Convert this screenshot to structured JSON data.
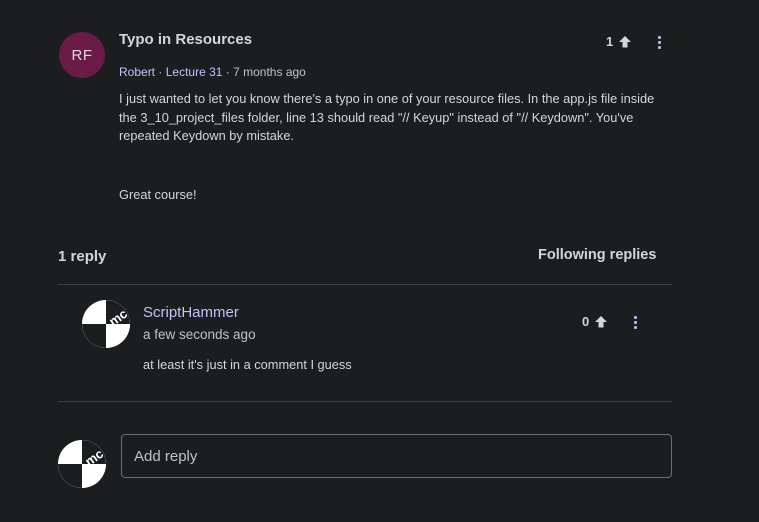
{
  "question": {
    "avatar_initials": "RF",
    "title": "Typo in Resources",
    "author": "Robert",
    "lecture": "Lecture 31",
    "time": "7 months ago",
    "separator": "·",
    "body_paragraph_1": "I just wanted to let you know there's a typo in one of your resource files.  In the app.js file inside the 3_10_project_files folder, line 13 should read \"// Keyup\" instead of \"// Keydown\".  You've repeated Keydown by mistake.",
    "body_paragraph_2": "Great course!",
    "upvotes": "1"
  },
  "replies_section": {
    "count_label": "1 reply",
    "follow_button": "Following replies"
  },
  "reply": {
    "author": "ScriptHammer",
    "time": "a few seconds ago",
    "body": "at least it's just in a comment I guess",
    "upvotes": "0"
  },
  "composer": {
    "placeholder": "Add reply"
  },
  "colors": {
    "background": "#1c1d1f",
    "accent": "#c0c4fc",
    "avatar_bg": "#6a1b46",
    "divider": "#3e4143"
  },
  "icons": {
    "upvote": "arrow-up-icon",
    "more": "kebab-menu-icon",
    "avatar": "user-avatar-logo"
  }
}
